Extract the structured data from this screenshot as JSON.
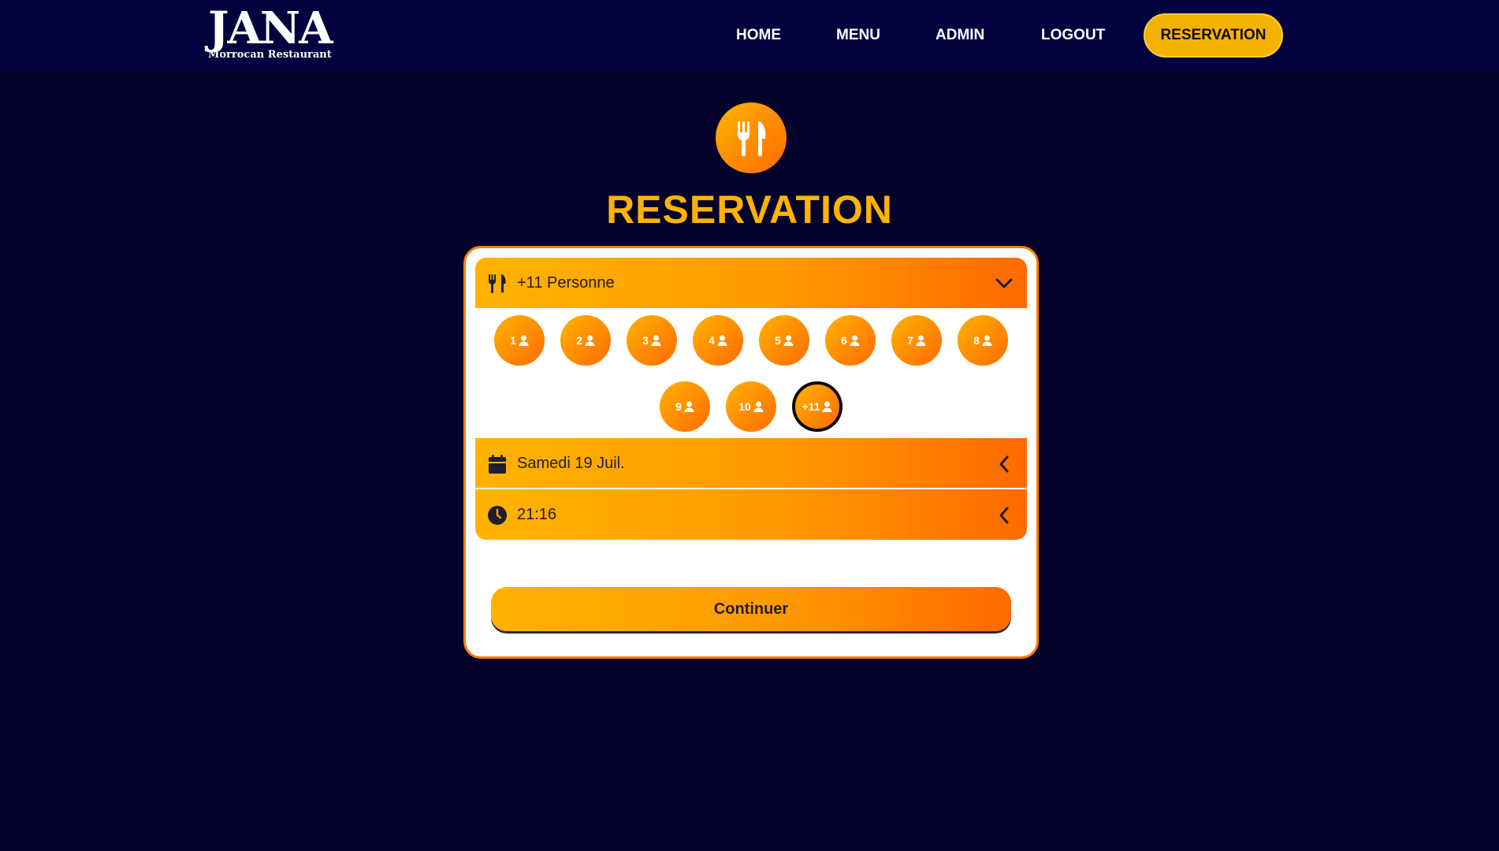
{
  "brand": {
    "name": "JANA",
    "subtitle": "Morrocan Restaurant"
  },
  "nav": {
    "home": "HOME",
    "menu": "MENU",
    "admin": "ADMIN",
    "logout": "LOGOUT",
    "reservation": "RESERVATION"
  },
  "page": {
    "title": "RESERVATION"
  },
  "reservation": {
    "party_label": "+11 Personne",
    "date_label": "Samedi 19 Juil.",
    "time_label": "21:16",
    "party_options": [
      "1",
      "2",
      "3",
      "4",
      "5",
      "6",
      "7",
      "8",
      "9",
      "10",
      "+11"
    ],
    "selected_option": "+11",
    "continue_label": "Continuer"
  },
  "colors": {
    "background": "#01012a",
    "header": "#02023f",
    "accent_yellow": "#ffb300",
    "accent_orange": "#ff6a00"
  },
  "icons": {
    "hero": "utensils-icon",
    "party": "utensils-icon",
    "date": "calendar-icon",
    "time": "clock-icon",
    "expand": "chevron-down-icon",
    "collapse": "chevron-left-icon",
    "person": "user-icon"
  }
}
